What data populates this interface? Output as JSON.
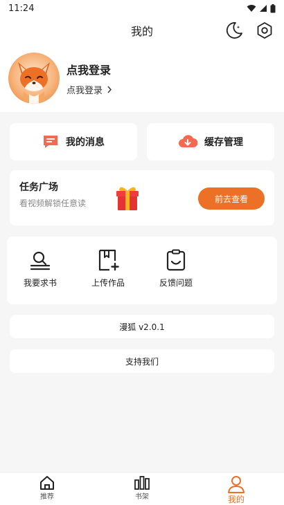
{
  "status": {
    "time": "11:24"
  },
  "header": {
    "title": "我的"
  },
  "profile": {
    "name": "点我登录",
    "sub_link": "点我登录"
  },
  "quick": {
    "messages": "我的消息",
    "cache": "缓存管理"
  },
  "task": {
    "title": "任务广场",
    "subtitle": "看视频解锁任意读",
    "button": "前去查看"
  },
  "tools": {
    "request_book": "我要求书",
    "upload": "上传作品",
    "feedback": "反馈问题"
  },
  "version": "漫狐 v2.0.1",
  "support": "支持我们",
  "tabs": {
    "recommend": "推荐",
    "shelf": "书架",
    "mine": "我的"
  },
  "colors": {
    "accent": "#ec7026",
    "background": "#f6f6f6",
    "card": "#ffffff"
  }
}
